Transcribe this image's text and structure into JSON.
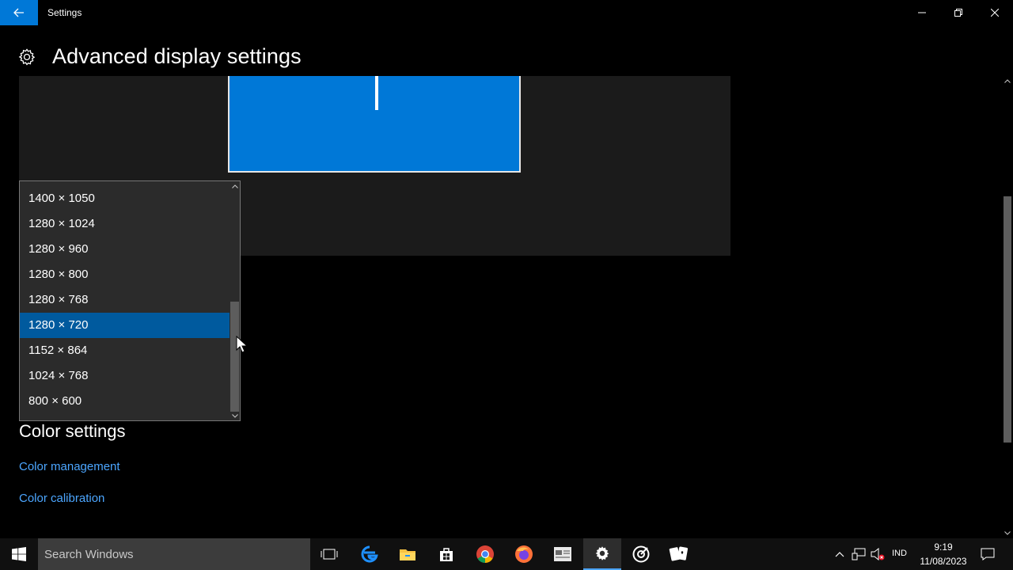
{
  "window": {
    "title": "Settings"
  },
  "header": {
    "title": "Advanced display settings"
  },
  "resolution_dropdown": {
    "options": [
      "1400 × 1050",
      "1280 × 1024",
      "1280 × 960",
      "1280 × 800",
      "1280 × 768",
      "1280 × 720",
      "1152 × 864",
      "1024 × 768",
      "800 × 600"
    ],
    "selected": "1280 × 720"
  },
  "color_settings": {
    "heading": "Color settings",
    "links": [
      "Color management",
      "Color calibration"
    ]
  },
  "taskbar": {
    "search_placeholder": "Search Windows",
    "language": "IND",
    "time": "9:19",
    "date": "11/08/2023"
  },
  "colors": {
    "accent": "#0078d7",
    "link": "#4ca6ff",
    "selected": "#005a9e"
  }
}
